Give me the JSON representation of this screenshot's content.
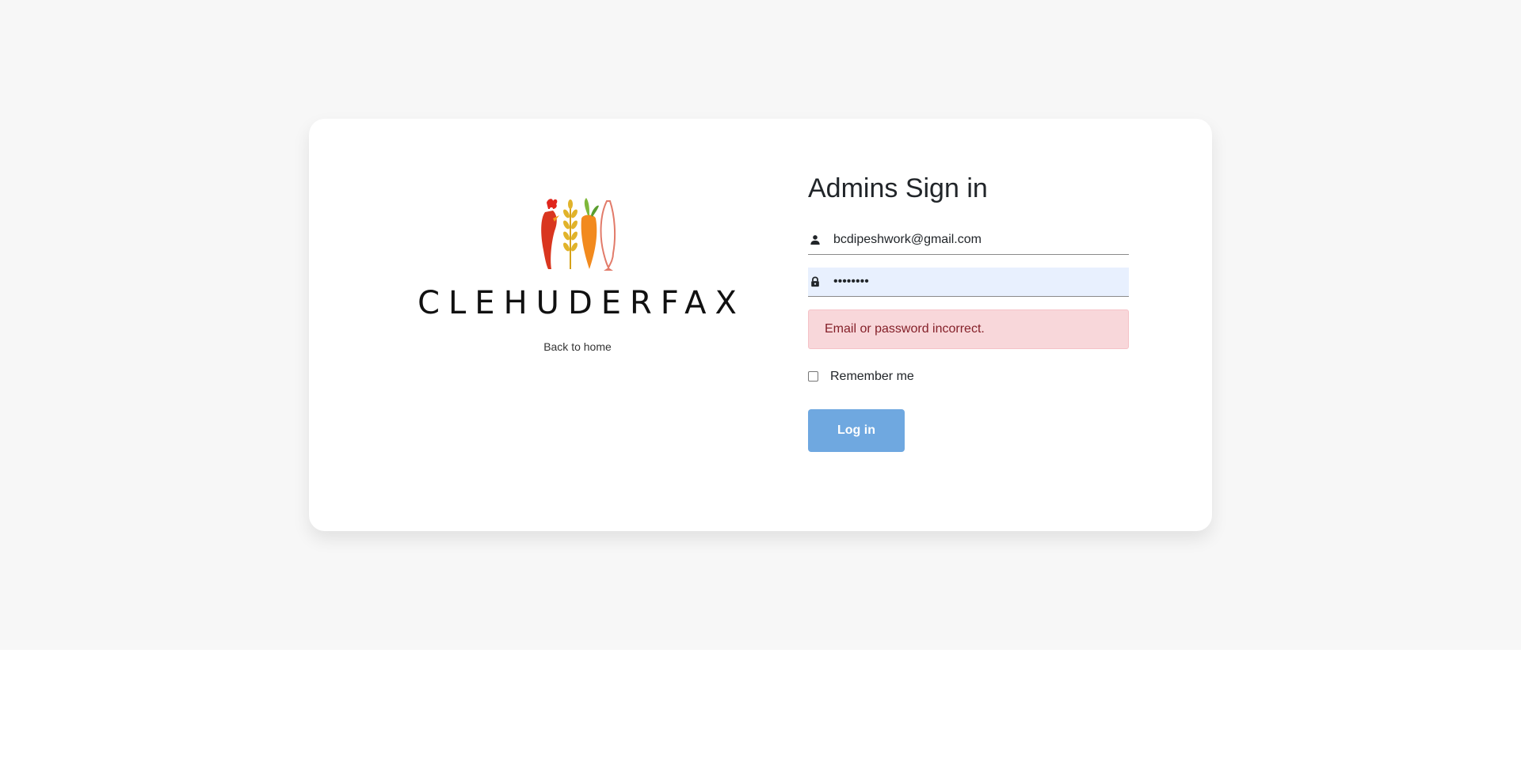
{
  "brand": {
    "wordmark": "CLEHUDERFAX",
    "back_link": "Back to home"
  },
  "form": {
    "title": "Admins Sign in",
    "email": {
      "value": "bcdipeshwork@gmail.com",
      "icon": "person-icon"
    },
    "password": {
      "value": "bcdipesh",
      "icon": "lock-icon"
    },
    "error": "Email or password incorrect.",
    "remember_label": "Remember me",
    "remember_checked": false,
    "submit_label": "Log in"
  },
  "colors": {
    "page_background": "#f7f7f7",
    "card_background": "#ffffff",
    "error_background": "#f8d7da",
    "error_text": "#842029",
    "button": "#6fa8e0",
    "autofill": "#e8f0fe"
  }
}
